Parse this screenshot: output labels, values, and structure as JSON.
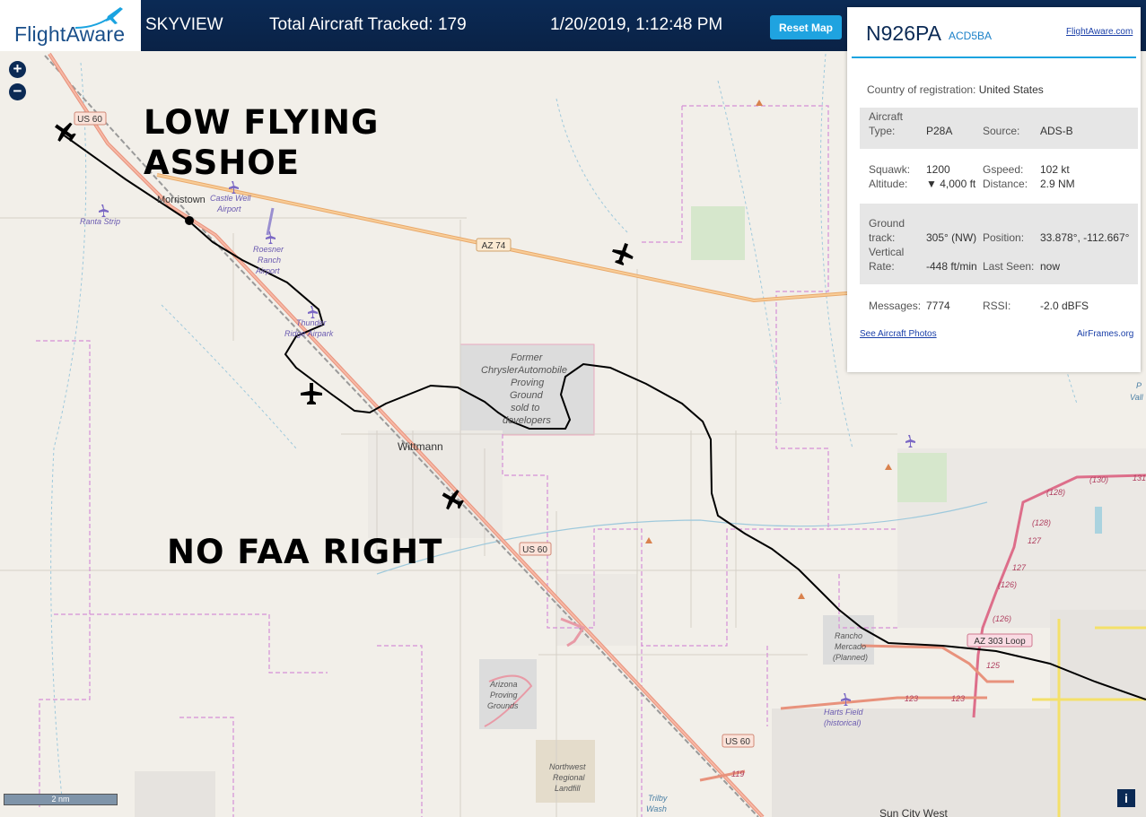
{
  "header": {
    "brand": "FlightAware",
    "title": "SKYVIEW",
    "tracked": "Total Aircraft Tracked: 179",
    "datetime": "1/20/2019, 1:12:48 PM",
    "reset_label": "Reset Map"
  },
  "map_controls": {
    "zoom_in": "+",
    "zoom_out": "−",
    "scale": "2 nm",
    "info": "i"
  },
  "overlay_text": {
    "line1": "LOW FLYING",
    "line2": "ASSHOE",
    "line3": "NO FAA RIGHT"
  },
  "map_labels": {
    "us60": "US 60",
    "az74": "AZ 74",
    "az303": "AZ 303 Loop",
    "morristown": "Morristown",
    "castle_well_1": "Castle Well",
    "castle_well_2": "Airport",
    "ranta": "Ranta Strip",
    "roesner_1": "Roesner",
    "roesner_2": "Ranch",
    "roesner_3": "Airport",
    "thunder_1": "Thunder",
    "thunder_2": "Ridge Airpark",
    "former_1": "Former",
    "former_2": "ChryslerAutomobile",
    "former_3": "Proving",
    "former_4": "Ground",
    "former_5": "sold to",
    "former_6": "developers",
    "wittmann": "Wittmann",
    "arizona_1": "Arizona",
    "arizona_2": "Proving",
    "arizona_3": "Grounds",
    "northwest_1": "Northwest",
    "northwest_2": "Regional",
    "northwest_3": "Landfill",
    "rancho_1": "Rancho",
    "rancho_2": "Mercado",
    "rancho_3": "(Planned)",
    "harts_1": "Harts Field",
    "harts_2": "(historical)",
    "trilby_1": "Trilby",
    "trilby_2": "Wash",
    "sun_city": "Sun City West",
    "r128a": "(128)",
    "r128b": "(128)",
    "r130": "(130)",
    "r131": "131",
    "r127a": "127",
    "r127b": "127",
    "r126a": "(126)",
    "r126b": "(126)",
    "r125": "125",
    "r123a": "123",
    "r123b": "123",
    "r119": "119",
    "p_frag": "P",
    "valle_frag": "Vall"
  },
  "panel": {
    "registration": "N926PA",
    "hex": "ACD5BA",
    "fa_link": "FlightAware.com",
    "country_label": "Country of registration:",
    "country": "United States",
    "aircraft_type_label_1": "Aircraft",
    "aircraft_type_label_2": "Type:",
    "aircraft_type": "P28A",
    "source_label": "Source:",
    "source": "ADS-B",
    "squawk_label": "Squawk:",
    "squawk": "1200",
    "gspeed_label": "Gspeed:",
    "gspeed": "102 kt",
    "altitude_label": "Altitude:",
    "altitude": "▼ 4,000 ft",
    "distance_label": "Distance:",
    "distance": "2.9 NM",
    "ground_label_1": "Ground",
    "ground_label_2": "track:",
    "ground_track": "305° (NW)",
    "position_label": "Position:",
    "position": "33.878°, -112.667°",
    "vrate_label_1": "Vertical",
    "vrate_label_2": "Rate:",
    "vertical_rate": "-448 ft/min",
    "last_seen_label": "Last Seen:",
    "last_seen": "now",
    "messages_label": "Messages:",
    "messages": "7774",
    "rssi_label": "RSSI:",
    "rssi": "-2.0 dBFS",
    "photos_link": "See Aircraft Photos",
    "airframes_link": "AirFrames.org"
  },
  "colors": {
    "header_bg": "#0b2a55",
    "accent": "#1fa3e0",
    "map_bg": "#f2efe9",
    "us60_road": "#e8927c",
    "az74_road": "#f4c28e",
    "boundary": "#d58fd6",
    "track": "#000000"
  }
}
